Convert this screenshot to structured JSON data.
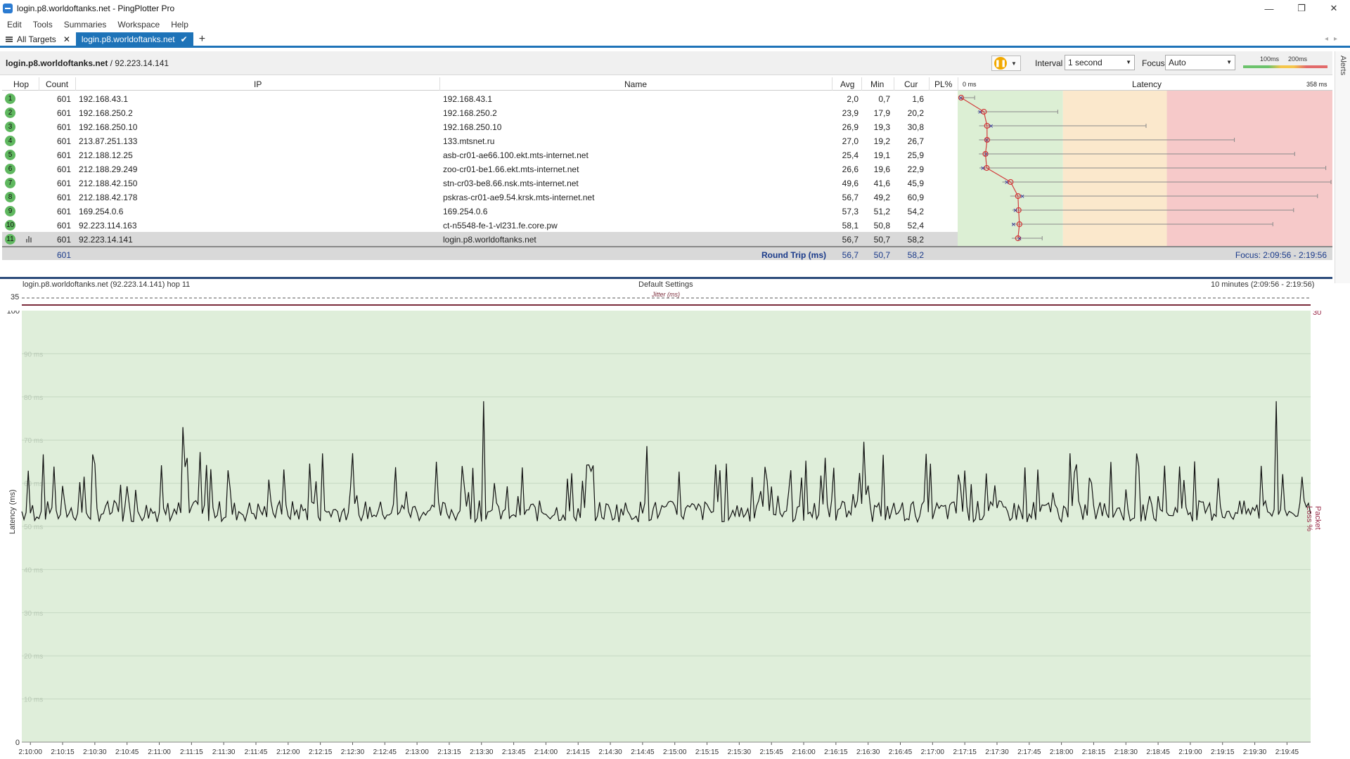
{
  "window": {
    "title": "login.p8.worldoftanks.net - PingPlotter Pro",
    "minimize": "—",
    "restore": "❐",
    "close": "✕"
  },
  "menu": [
    "Edit",
    "Tools",
    "Summaries",
    "Workspace",
    "Help"
  ],
  "tabs": {
    "all_targets": "All Targets",
    "active": "login.p8.worldoftanks.net",
    "add": "+"
  },
  "target": {
    "host": "login.p8.worldoftanks.net",
    "ip": " / 92.223.14.141",
    "interval_label": "Interval",
    "interval_value": "1 second",
    "focus_label": "Focus",
    "focus_value": "Auto",
    "scale_100": "100ms",
    "scale_200": "200ms",
    "alerts": "Alerts"
  },
  "columns": {
    "hop": "Hop",
    "count": "Count",
    "ip": "IP",
    "name": "Name",
    "avg": "Avg",
    "min": "Min",
    "cur": "Cur",
    "pl": "PL%",
    "latency": "Latency",
    "lat_min": "0 ms",
    "lat_max": "358 ms"
  },
  "hops": [
    {
      "hop": "1",
      "count": "601",
      "ip": "192.168.43.1",
      "name": "192.168.43.1",
      "avg": "2,0",
      "min": "0,7",
      "cur": "1,6",
      "max": 15
    },
    {
      "hop": "2",
      "count": "601",
      "ip": "192.168.250.2",
      "name": "192.168.250.2",
      "avg": "23,9",
      "min": "17,9",
      "cur": "20,2",
      "max": 95
    },
    {
      "hop": "3",
      "count": "601",
      "ip": "192.168.250.10",
      "name": "192.168.250.10",
      "avg": "26,9",
      "min": "19,3",
      "cur": "30,8",
      "max": 180
    },
    {
      "hop": "4",
      "count": "601",
      "ip": "213.87.251.133",
      "name": "133.mtsnet.ru",
      "avg": "27,0",
      "min": "19,2",
      "cur": "26,7",
      "max": 265
    },
    {
      "hop": "5",
      "count": "601",
      "ip": "212.188.12.25",
      "name": "asb-cr01-ae66.100.ekt.mts-internet.net",
      "avg": "25,4",
      "min": "19,1",
      "cur": "25,9",
      "max": 323
    },
    {
      "hop": "6",
      "count": "601",
      "ip": "212.188.29.249",
      "name": "zoo-cr01-be1.66.ekt.mts-internet.net",
      "avg": "26,6",
      "min": "19,6",
      "cur": "22,9",
      "max": 353
    },
    {
      "hop": "7",
      "count": "601",
      "ip": "212.188.42.150",
      "name": "stn-cr03-be8.66.nsk.mts-internet.net",
      "avg": "49,6",
      "min": "41,6",
      "cur": "45,9",
      "max": 358
    },
    {
      "hop": "8",
      "count": "601",
      "ip": "212.188.42.178",
      "name": "pskras-cr01-ae9.54.krsk.mts-internet.net",
      "avg": "56,7",
      "min": "49,2",
      "cur": "60,9",
      "max": 345
    },
    {
      "hop": "9",
      "count": "601",
      "ip": "169.254.0.6",
      "name": "169.254.0.6",
      "avg": "57,3",
      "min": "51,2",
      "cur": "54,2",
      "max": 322
    },
    {
      "hop": "10",
      "count": "601",
      "ip": "92.223.114.163",
      "name": "ct-n5548-fe-1-vl231.fe.core.pw",
      "avg": "58,1",
      "min": "50,8",
      "cur": "52,4",
      "max": 302
    },
    {
      "hop": "11",
      "count": "601",
      "ip": "92.223.14.141",
      "name": "login.p8.worldoftanks.net",
      "avg": "56,7",
      "min": "50,7",
      "cur": "58,2",
      "max": 80
    }
  ],
  "summary": {
    "count": "601",
    "label": "Round Trip (ms)",
    "avg": "56,7",
    "min": "50,7",
    "cur": "58,2",
    "focus": "Focus: 2:09:56 - 2:19:56"
  },
  "graph": {
    "title_left": "login.p8.worldoftanks.net (92.223.14.141) hop 11",
    "title_center": "Default Settings",
    "title_right": "10 minutes (2:09:56 - 2:19:56)",
    "jitter_label": "Jitter (ms)",
    "jitter_max": "35",
    "y_top": "100",
    "y_bottom": "0",
    "y2_top": "30",
    "y_title": "Latency (ms)",
    "y2_title": "Packet Loss %",
    "gridlines": [
      "90 ms",
      "80 ms",
      "70 ms",
      "60 ms",
      "50 ms",
      "40 ms",
      "30 ms",
      "20 ms",
      "10 ms"
    ],
    "x_ticks": [
      "2:10:00",
      "2:10:15",
      "2:10:30",
      "2:10:45",
      "2:11:00",
      "2:11:15",
      "2:11:30",
      "2:11:45",
      "2:12:00",
      "2:12:15",
      "2:12:30",
      "2:12:45",
      "2:13:00",
      "2:13:15",
      "2:13:30",
      "2:13:45",
      "2:14:00",
      "2:14:15",
      "2:14:30",
      "2:14:45",
      "2:15:00",
      "2:15:15",
      "2:15:30",
      "2:15:45",
      "2:16:00",
      "2:16:15",
      "2:16:30",
      "2:16:45",
      "2:17:00",
      "2:17:15",
      "2:17:30",
      "2:17:45",
      "2:18:00",
      "2:18:15",
      "2:18:30",
      "2:18:45",
      "2:19:00",
      "2:19:15",
      "2:19:30",
      "2:19:45"
    ],
    "colors": {
      "bg": "#dfeeda",
      "line": "#111111",
      "grid": "#c6d8c2"
    }
  }
}
